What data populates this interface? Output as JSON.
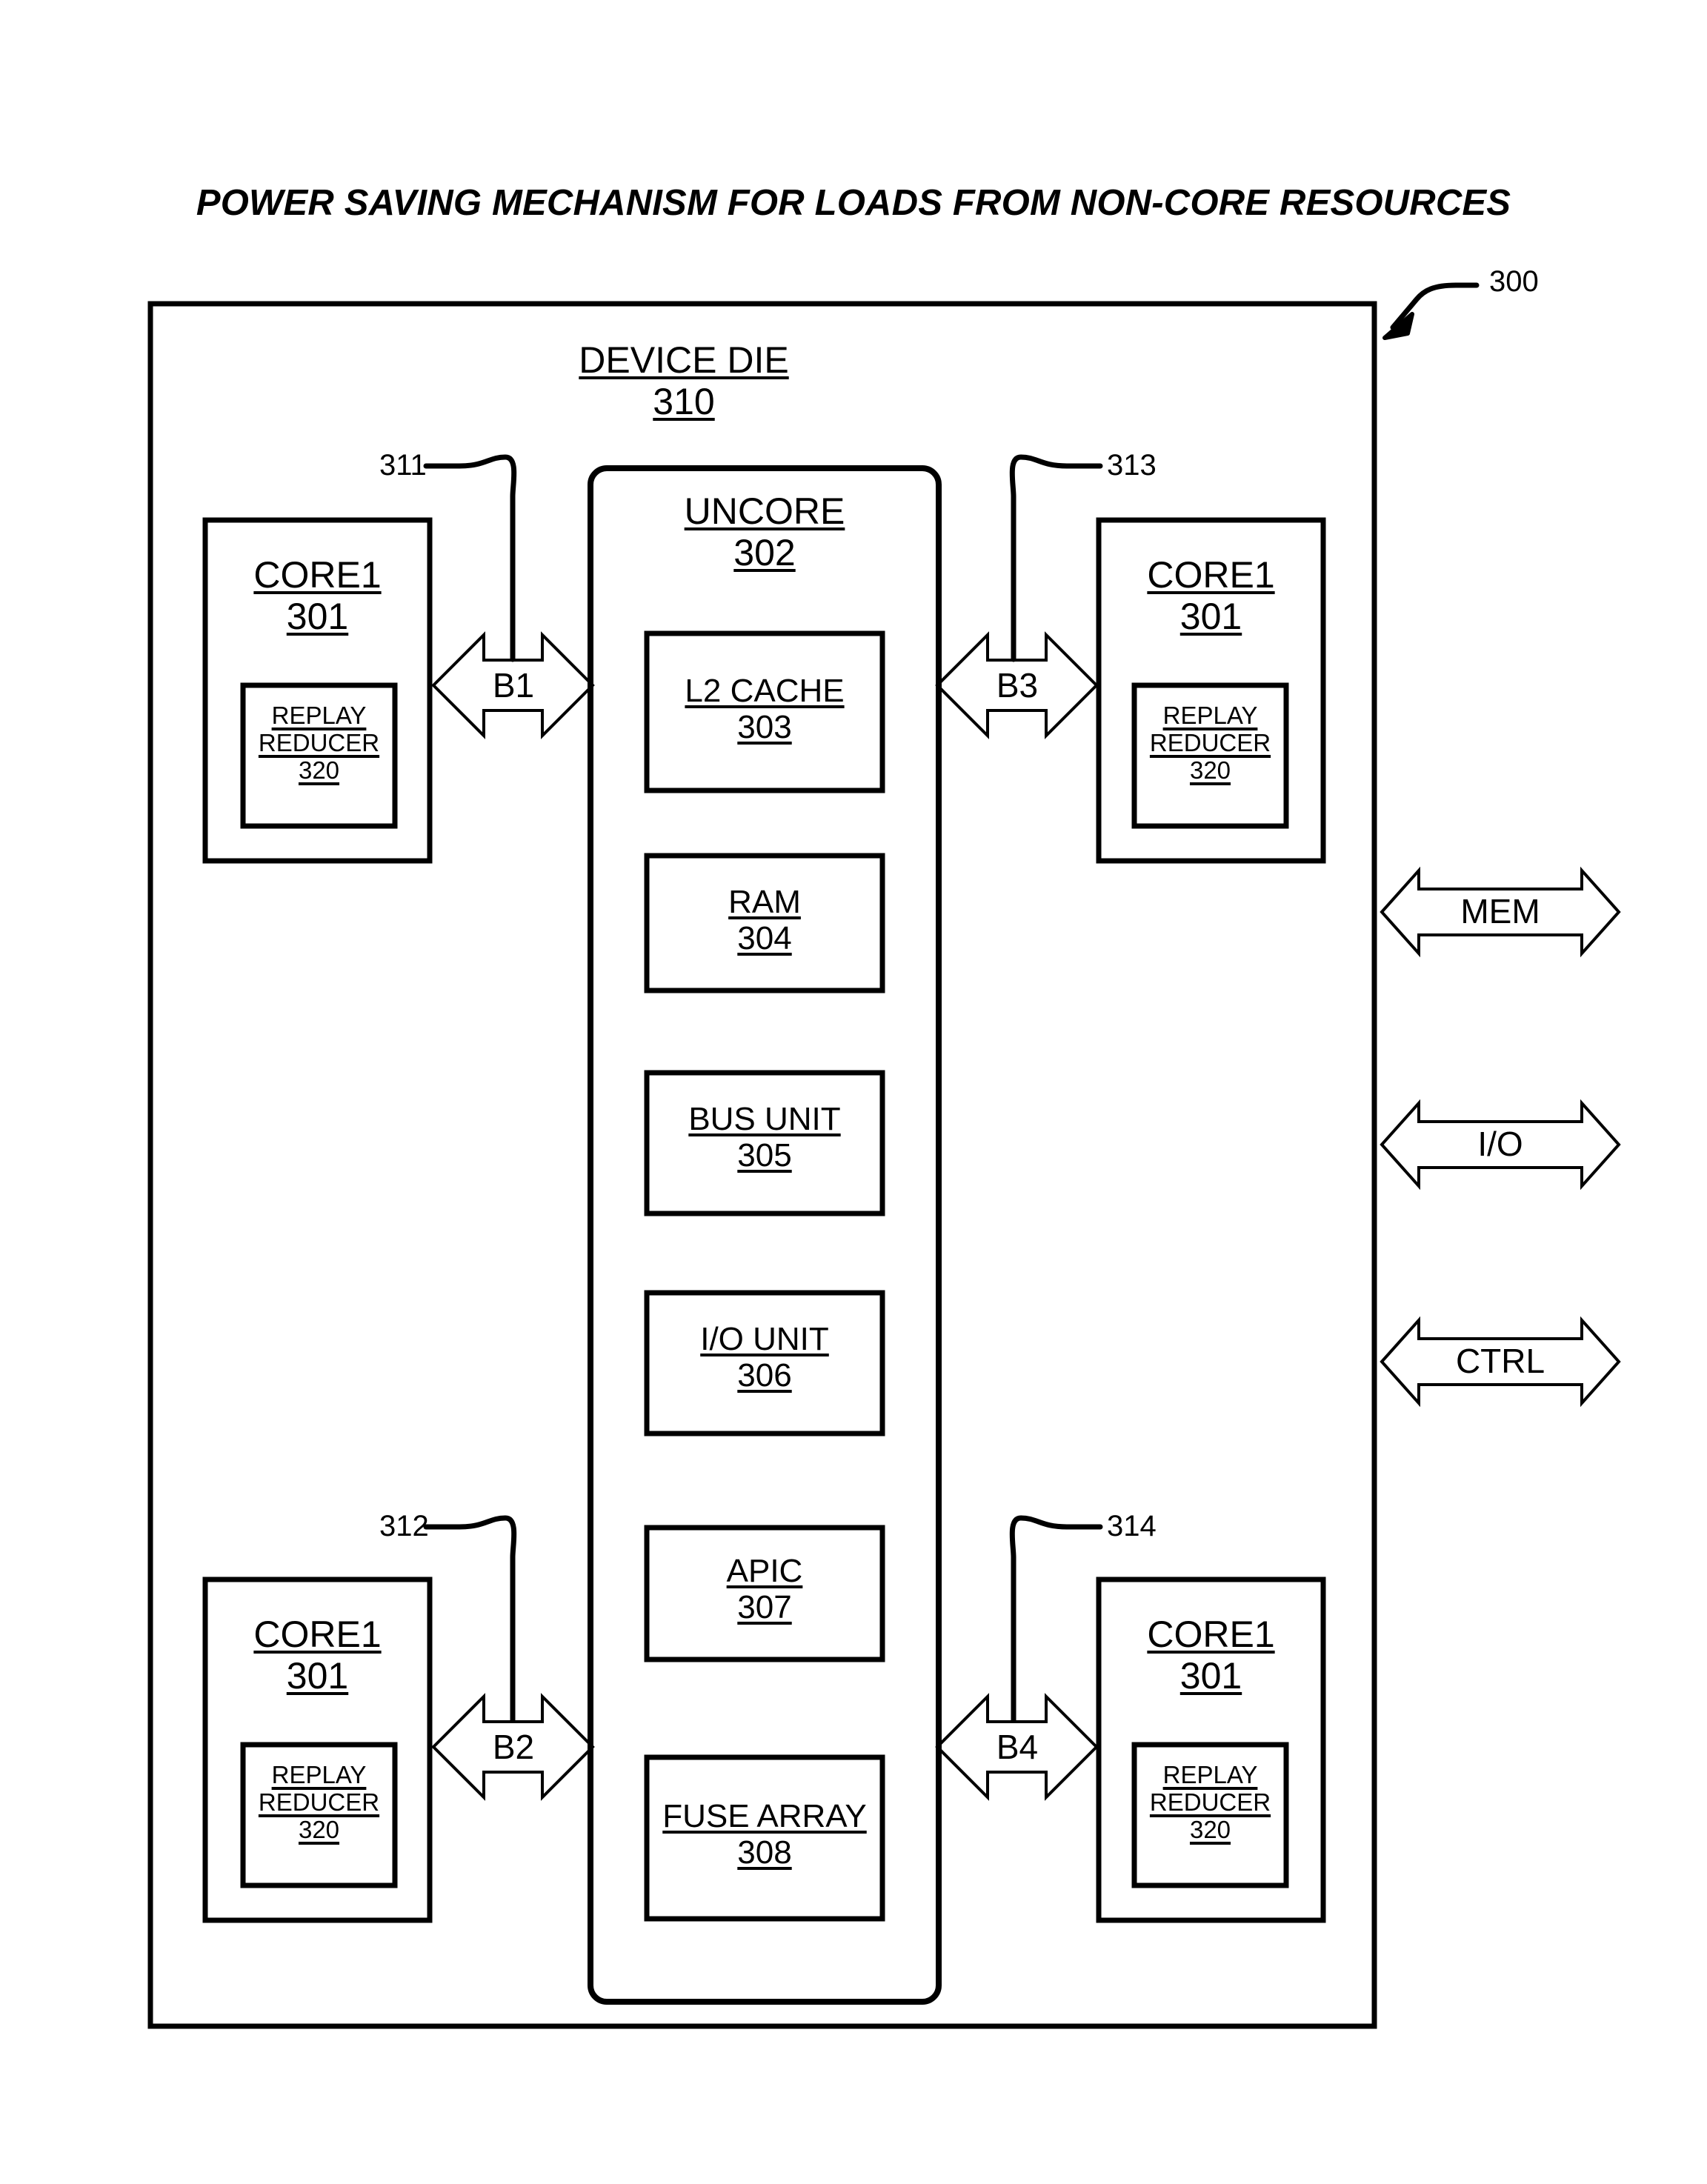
{
  "figure": {
    "title": "POWER SAVING MECHANISM FOR LOADS FROM NON-CORE RESOURCES",
    "figure_ref": "300"
  },
  "device_die": {
    "name": "DEVICE DIE",
    "ref": "310"
  },
  "uncore": {
    "name": "UNCORE",
    "ref": "302",
    "blocks": [
      {
        "name": "L2 CACHE",
        "ref": "303"
      },
      {
        "name": "RAM",
        "ref": "304"
      },
      {
        "name": "BUS UNIT",
        "ref": "305"
      },
      {
        "name": "I/O UNIT",
        "ref": "306"
      },
      {
        "name": "APIC",
        "ref": "307"
      },
      {
        "name": "FUSE ARRAY",
        "ref": "308"
      }
    ]
  },
  "cores": [
    {
      "position": "top-left",
      "name": "CORE1",
      "ref": "301",
      "sub_name_line1": "REPLAY",
      "sub_name_line2": "REDUCER",
      "sub_ref": "320"
    },
    {
      "position": "top-right",
      "name": "CORE1",
      "ref": "301",
      "sub_name_line1": "REPLAY",
      "sub_name_line2": "REDUCER",
      "sub_ref": "320"
    },
    {
      "position": "bottom-left",
      "name": "CORE1",
      "ref": "301",
      "sub_name_line1": "REPLAY",
      "sub_name_line2": "REDUCER",
      "sub_ref": "320"
    },
    {
      "position": "bottom-right",
      "name": "CORE1",
      "ref": "301",
      "sub_name_line1": "REPLAY",
      "sub_name_line2": "REDUCER",
      "sub_ref": "320"
    }
  ],
  "buses": [
    {
      "label": "B1",
      "ref": "311",
      "position": "top-left"
    },
    {
      "label": "B2",
      "ref": "312",
      "position": "bottom-left"
    },
    {
      "label": "B3",
      "ref": "313",
      "position": "top-right"
    },
    {
      "label": "B4",
      "ref": "314",
      "position": "bottom-right"
    }
  ],
  "external_interfaces": [
    {
      "label": "MEM"
    },
    {
      "label": "I/O"
    },
    {
      "label": "CTRL"
    }
  ],
  "colors": {
    "line": "#000000",
    "background": "#ffffff"
  }
}
